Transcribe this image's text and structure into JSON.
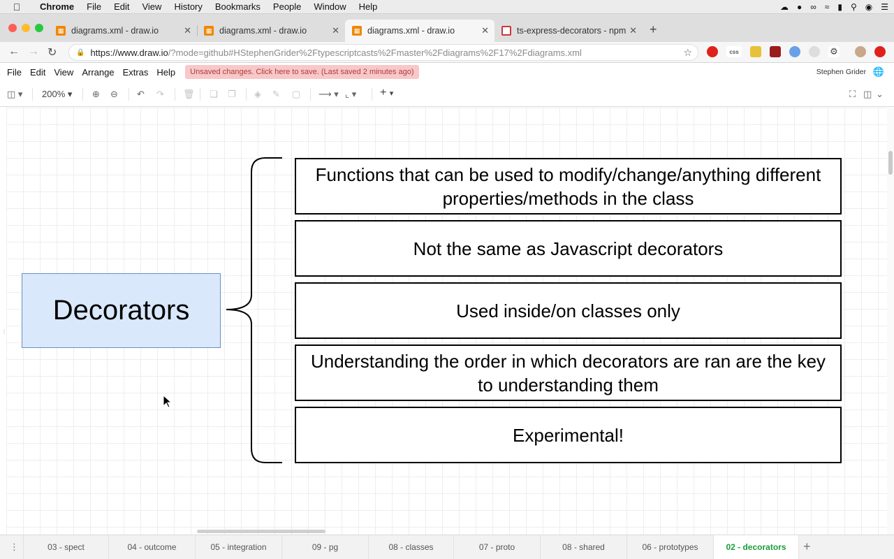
{
  "menubar": {
    "app": "Chrome",
    "items": [
      "File",
      "Edit",
      "View",
      "History",
      "Bookmarks",
      "People",
      "Window",
      "Help"
    ]
  },
  "tabs": [
    {
      "title": "diagrams.xml - draw.io",
      "active": false
    },
    {
      "title": "diagrams.xml - draw.io",
      "active": false
    },
    {
      "title": "diagrams.xml - draw.io",
      "active": true
    },
    {
      "title": "ts-express-decorators - npm",
      "active": false
    }
  ],
  "address": {
    "url_main": "https://www.draw.io",
    "url_rest": "/?mode=github#HStephenGrider%2Ftypescriptcasts%2Fmaster%2Fdiagrams%2F17%2Fdiagrams.xml"
  },
  "app_menu": {
    "items": [
      "File",
      "Edit",
      "View",
      "Arrange",
      "Extras",
      "Help"
    ],
    "unsaved_notice": "Unsaved changes. Click here to save. (Last saved 2 minutes ago)",
    "user": "Stephen Grider"
  },
  "toolbar": {
    "zoom": "200%"
  },
  "diagram": {
    "main_label": "Decorators",
    "items": [
      "Functions that can be used to modify/change/anything different properties/methods in the class",
      "Not the same as Javascript decorators",
      "Used inside/on classes only",
      "Understanding the order in which decorators are ran are the key to understanding them",
      "Experimental!"
    ],
    "colors": {
      "main_fill": "#dae8fc",
      "main_stroke": "#6c8ebf"
    }
  },
  "page_tabs": [
    {
      "label": "03 - spect",
      "active": false
    },
    {
      "label": "04 - outcome",
      "active": false
    },
    {
      "label": "05 - integration",
      "active": false
    },
    {
      "label": "09 - pg",
      "active": false
    },
    {
      "label": "08 - classes",
      "active": false
    },
    {
      "label": "07 - proto",
      "active": false
    },
    {
      "label": "08 - shared",
      "active": false
    },
    {
      "label": "06 - prototypes",
      "active": false
    },
    {
      "label": "02 - decorators",
      "active": true
    }
  ]
}
